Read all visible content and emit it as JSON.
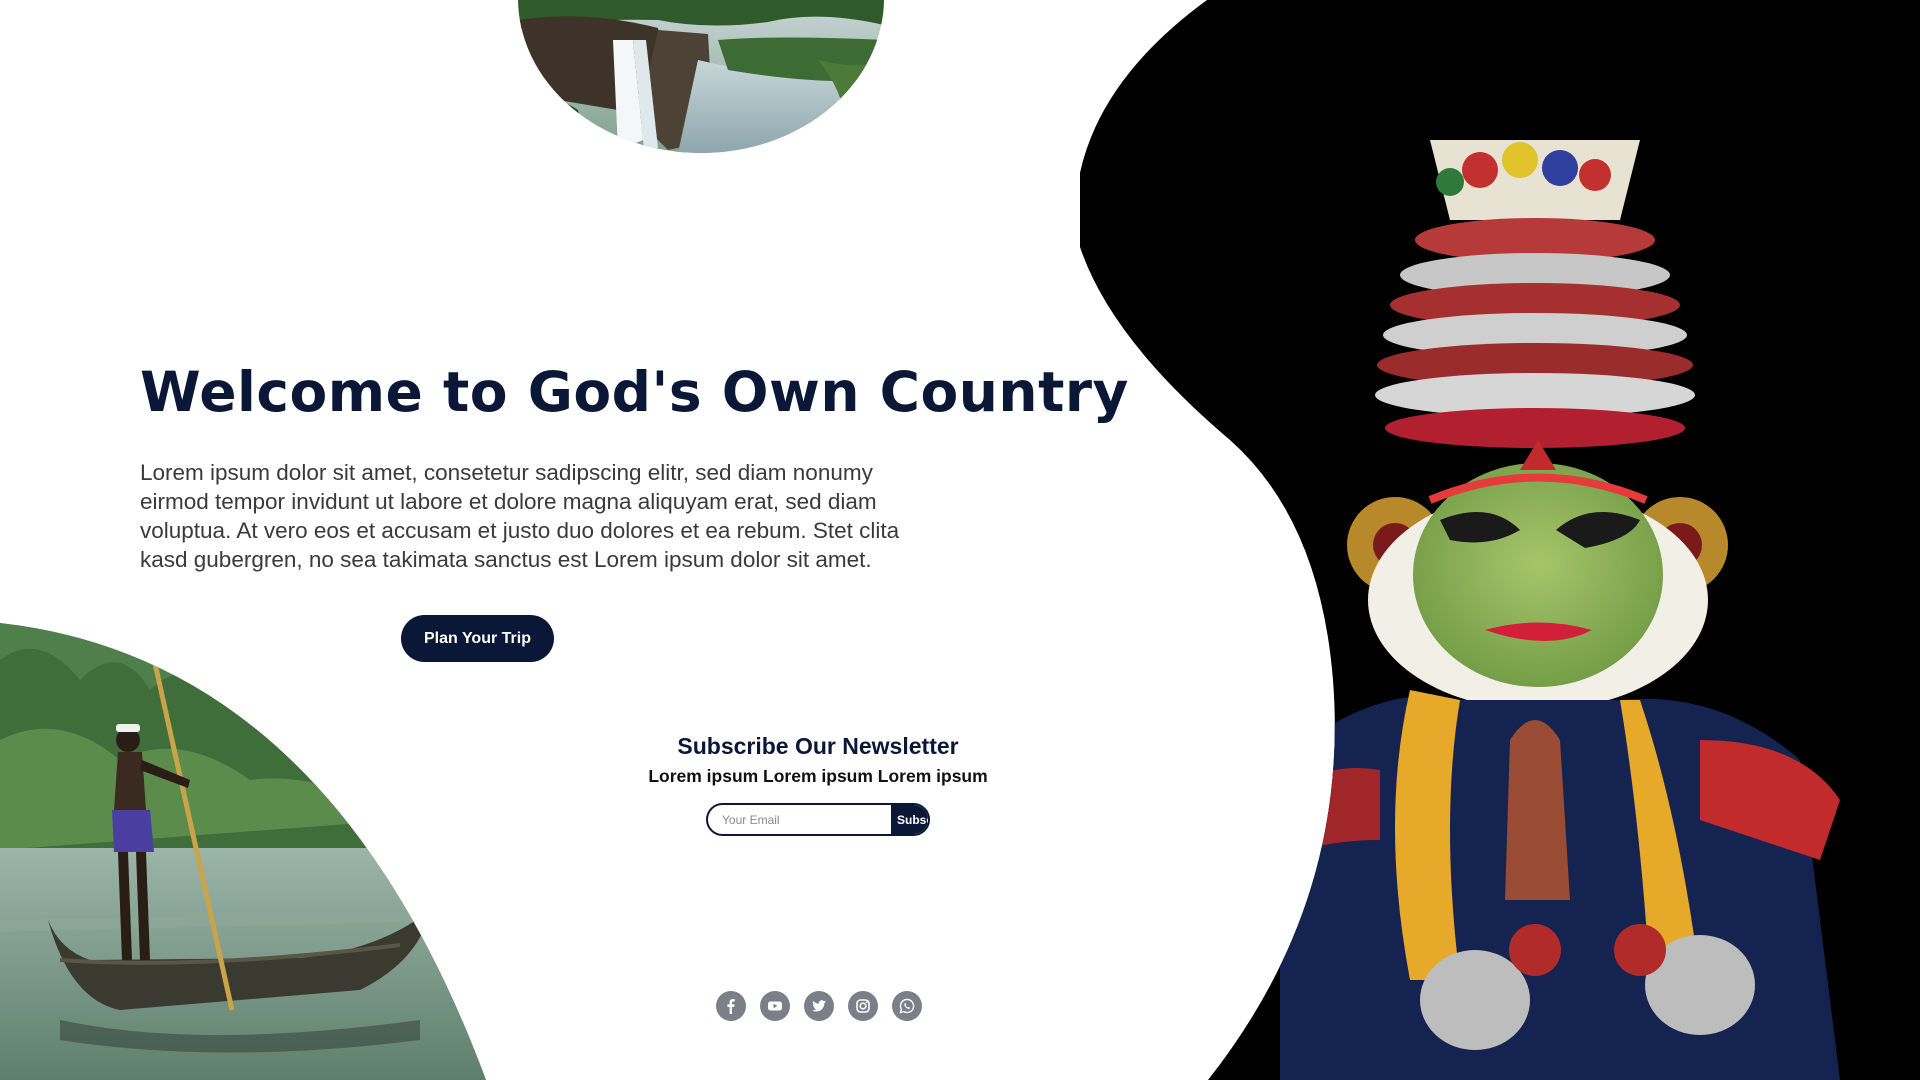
{
  "hero": {
    "title": "Welcome to God's Own Country",
    "description": "Lorem ipsum dolor sit amet, consetetur sadipscing elitr, sed diam nonumy eirmod tempor invidunt ut labore et dolore magna aliquyam erat, sed diam voluptua. At vero eos et accusam et justo duo dolores et ea rebum. Stet clita kasd gubergren, no sea takimata sanctus est Lorem ipsum dolor sit amet.",
    "cta_label": "Plan Your Trip"
  },
  "newsletter": {
    "title": "Subscribe Our Newsletter",
    "subtitle": "Lorem ipsum Lorem ipsum Lorem ipsum",
    "email_placeholder": "Your Email",
    "submit_label": "Subscribe"
  },
  "social": {
    "icons": [
      "facebook-icon",
      "youtube-icon",
      "twitter-icon",
      "instagram-icon",
      "whatsapp-icon"
    ]
  },
  "colors": {
    "brand_navy": "#0b1736",
    "social_grey": "#7b7f87",
    "hero_background_black": "#000000"
  }
}
